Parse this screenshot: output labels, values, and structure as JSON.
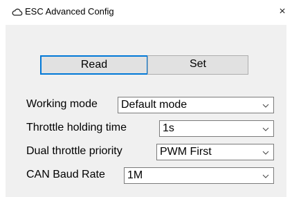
{
  "window": {
    "title": "ESC Advanced Config",
    "close_glyph": "×"
  },
  "buttons": {
    "read": "Read",
    "set": "Set"
  },
  "fields": [
    {
      "label": "Working mode",
      "value": "Default mode"
    },
    {
      "label": "Throttle holding time",
      "value": "1s"
    },
    {
      "label": "Dual throttle priority",
      "value": "PWM First"
    },
    {
      "label": "CAN Baud Rate",
      "value": "1M"
    }
  ],
  "colors": {
    "focus_border": "#0078d7",
    "client_bg": "#f0f0f0"
  }
}
